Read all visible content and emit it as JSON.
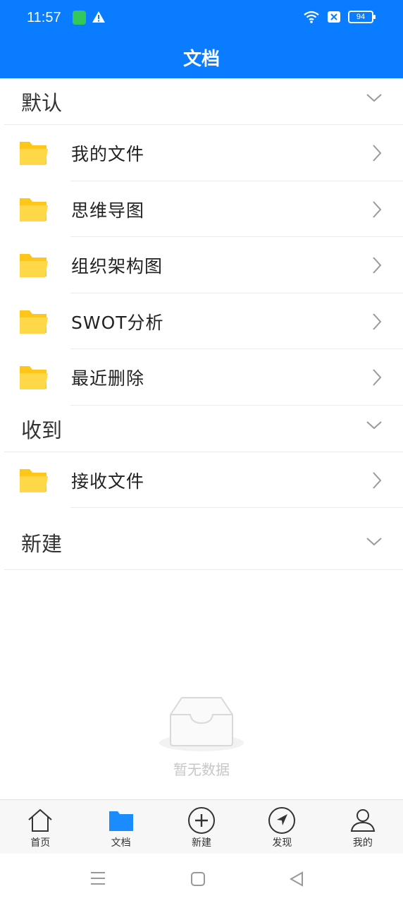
{
  "status_bar": {
    "time": "11:57",
    "battery": "94",
    "icons": [
      "app-notification-icon",
      "warning-icon",
      "wifi-icon",
      "sim-off-icon",
      "battery-icon"
    ]
  },
  "header": {
    "title": "文档"
  },
  "groups": [
    {
      "title": "默认",
      "items": [
        {
          "label": "我的文件"
        },
        {
          "label": "思维导图"
        },
        {
          "label": "组织架构图"
        },
        {
          "label": "SWOT分析"
        },
        {
          "label": "最近删除"
        }
      ]
    },
    {
      "title": "收到",
      "items": [
        {
          "label": "接收文件"
        }
      ]
    },
    {
      "title": "新建",
      "items": []
    }
  ],
  "empty_state": {
    "text": "暂无数据"
  },
  "tabbar": {
    "tabs": [
      {
        "label": "首页",
        "icon": "home-icon"
      },
      {
        "label": "文档",
        "icon": "folder-icon",
        "active": true
      },
      {
        "label": "新建",
        "icon": "plus-circle-icon"
      },
      {
        "label": "发现",
        "icon": "compass-icon"
      },
      {
        "label": "我的",
        "icon": "user-icon"
      }
    ]
  },
  "colors": {
    "primary": "#0a7cff",
    "folder": "#ffcc29",
    "folder_front": "#ffd84a"
  }
}
